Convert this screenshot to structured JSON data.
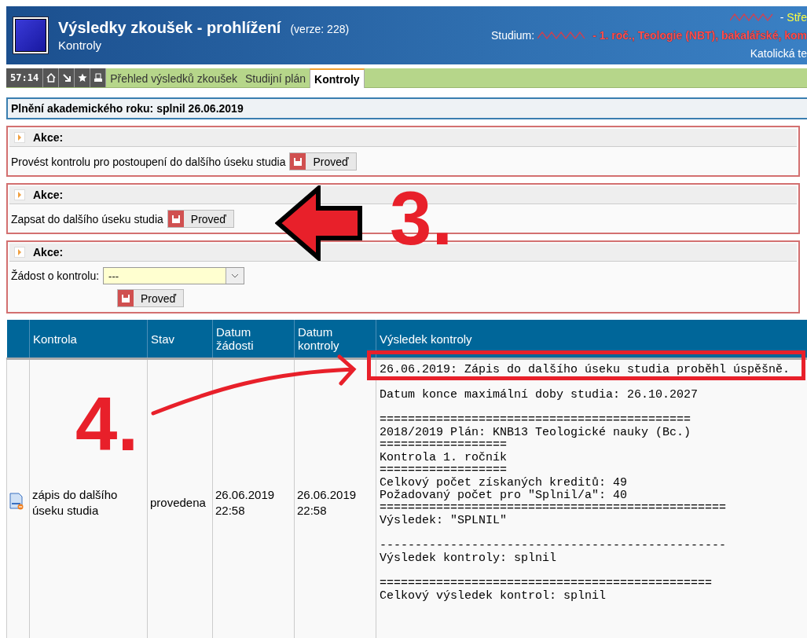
{
  "header": {
    "title": "Výsledky zkoušek - prohlížení",
    "version": "(verze: 228)",
    "subtitle": "Kontroly",
    "user_line": {
      "separator": "-",
      "role": "Stře"
    },
    "study_line": {
      "label": "Studium:",
      "value": "- 1. roč., Teologie (NBT), bakalářské, kom"
    },
    "faculty": "Katolická te"
  },
  "toolbar": {
    "timer": "57:14"
  },
  "tabs": [
    {
      "label": "Přehled výsledků zkoušek",
      "selected": false
    },
    {
      "label": "Studijní plán",
      "selected": false
    },
    {
      "label": "Kontroly",
      "selected": true
    }
  ],
  "status": "Plnění akademického roku: splnil 26.06.2019",
  "actions": [
    {
      "title": "Akce:",
      "kind": "button",
      "label": "Provést kontrolu pro postoupení do dalšího úseku studia",
      "button": "Proveď"
    },
    {
      "title": "Akce:",
      "kind": "button",
      "label": "Zapsat do dalšího úseku studia",
      "button": "Proveď"
    },
    {
      "title": "Akce:",
      "kind": "select",
      "label": "Žádost o kontrolu:",
      "value": "---",
      "button": "Proveď"
    }
  ],
  "table": {
    "columns": [
      "Kontrola",
      "Stav",
      "Datum žádosti",
      "Datum kontroly",
      "Výsledek kontroly"
    ],
    "rows": [
      {
        "kontrola": "zápis do dalšího úseku studia",
        "stav": "provedena",
        "datum_zadosti": "26.06.2019 22:58",
        "datum_kontroly": "26.06.2019 22:58",
        "result_blocks": [
          {
            "highlighted": true,
            "lines": [
              "26.06.2019: Zápis do dalšího úseku studia proběhl úspěšně."
            ]
          },
          {
            "highlighted": false,
            "lines": [
              "Datum konce maximální doby studia: 26.10.2027"
            ]
          },
          {
            "highlighted": false,
            "lines": [
              "============================================",
              "2018/2019 Plán: KNB13 Teologické nauky (Bc.)",
              "==================",
              "Kontrola 1. ročník",
              "==================",
              "Celkový počet získaných kreditů: 49",
              "Požadovaný počet pro \"Splnil/a\": 40",
              "=================================================",
              "Výsledek: \"SPLNIL\""
            ]
          },
          {
            "highlighted": false,
            "lines": [
              "-------------------------------------------------",
              "Výsledek kontroly: splnil"
            ]
          },
          {
            "highlighted": false,
            "lines": [
              "===============================================",
              "Celkový výsledek kontrol: splnil"
            ]
          }
        ]
      }
    ]
  },
  "annotations": [
    {
      "kind": "block_arrow"
    },
    {
      "kind": "label",
      "text": "3."
    },
    {
      "kind": "label",
      "text": "4."
    },
    {
      "kind": "curved_arrow"
    }
  ]
}
